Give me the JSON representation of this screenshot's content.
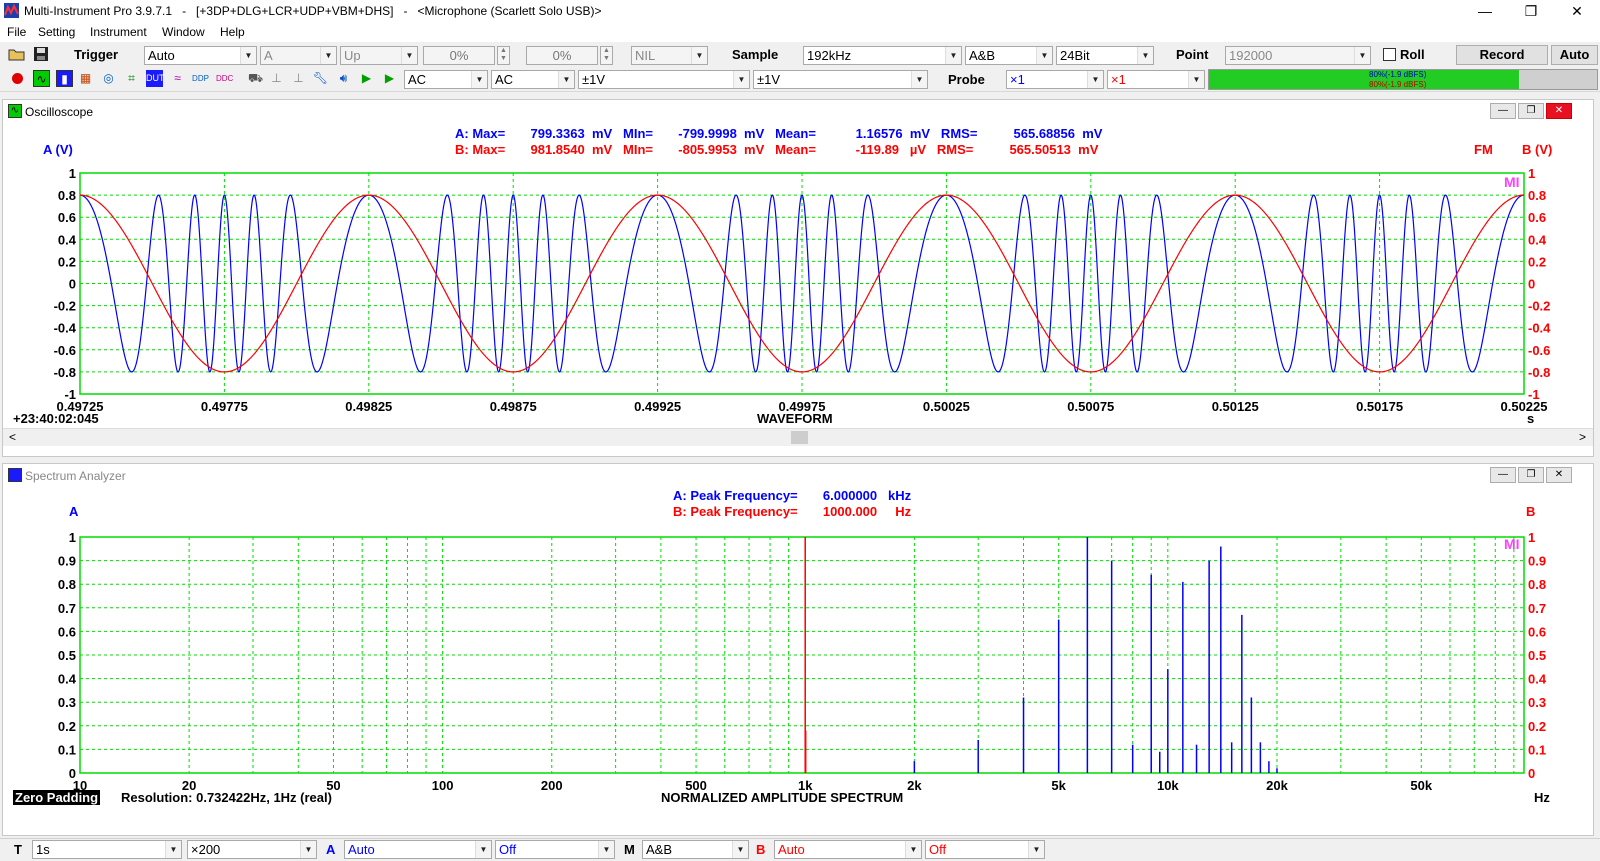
{
  "window": {
    "title": "Multi-Instrument Pro 3.9.7.1   -   [+3DP+DLG+LCR+UDP+VBM+DHS]   -   <Microphone (Scarlett Solo USB)>",
    "min_glyph": "—",
    "max_glyph": "❐",
    "close_glyph": "✕"
  },
  "menu": [
    "File",
    "Setting",
    "Instrument",
    "Window",
    "Help"
  ],
  "toolbar1": {
    "trigger_label": "Trigger",
    "trigger_mode": "Auto",
    "trigger_source": "A",
    "trigger_edge": "Up",
    "level1": "0%",
    "level2": "0%",
    "nil": "NIL",
    "sample_label": "Sample",
    "sample_rate": "192kHz",
    "channels": "A&B",
    "bits": "24Bit",
    "point_label": "Point",
    "points": "192000",
    "roll_label": "Roll",
    "record_label": "Record",
    "auto_label": "Auto"
  },
  "toolbar2": {
    "coupling_a": "AC",
    "coupling_b": "AC",
    "range_a": "±1V",
    "range_b": "±1V",
    "probe_label": "Probe",
    "probe_a": "×1",
    "probe_b": "×1",
    "meter_a": "80%(-1.9 dBFS)",
    "meter_b": "80%(-1.9 dBFS)",
    "meter_a_level": 0.8,
    "meter_b_level": 0.8
  },
  "colors": {
    "channel_a": "#0000ff",
    "channel_b": "#ff0000",
    "grid": "#00dd00",
    "meter_green": "#22cc22",
    "meter_yellow": "#dddd00"
  },
  "oscilloscope": {
    "title": "Oscilloscope",
    "a_axis_label": "A (V)",
    "b_axis_label": "B (V)",
    "mode_label": "FM",
    "watermark": "MI",
    "stats_a": "A: Max=       799.3363  mV   MIn=       -799.9998  mV   Mean=           1.16576  mV   RMS=          565.68856  mV",
    "stats_b": "B: Max=       981.8540  mV   MIn=       -805.9953  mV   Mean=           -119.89   µV   RMS=          565.50513  mV",
    "time_stamp": "+23:40:02:045",
    "x_title": "WAVEFORM",
    "x_unit": "s",
    "scroll_left": "<",
    "scroll_right": ">"
  },
  "spectrum": {
    "title": "Spectrum Analyzer",
    "a_axis_label": "A",
    "b_axis_label": "B",
    "watermark": "MI",
    "peak_a": "A: Peak Frequency=       6.000000   kHz",
    "peak_b": "B: Peak Frequency=       1000.000     Hz",
    "zero_padding_label": "Zero Padding",
    "resolution": "Resolution: 0.732422Hz, 1Hz (real)",
    "x_title": "NORMALIZED AMPLITUDE SPECTRUM",
    "x_unit": "Hz"
  },
  "bottom_bar": {
    "t_label": "T",
    "time_base": "1s",
    "zoom": "×200",
    "a_label": "A",
    "a_scale": "Auto",
    "a_mode": "Off",
    "m_label": "M",
    "m_value": "A&B",
    "b_label": "B",
    "b_scale": "Auto",
    "b_mode": "Off"
  },
  "chart_data": [
    {
      "type": "line",
      "title": "WAVEFORM",
      "xlabel": "s",
      "ylabel_left": "A (V)",
      "ylabel_right": "B (V)",
      "xlim": [
        0.49725,
        0.50225
      ],
      "ylim": [
        -1,
        1
      ],
      "x_ticks": [
        "0.49725",
        "0.49775",
        "0.49825",
        "0.49875",
        "0.49925",
        "0.49975",
        "0.50025",
        "0.50075",
        "0.50125",
        "0.50175",
        "0.50225"
      ],
      "y_ticks": [
        "1",
        "0.8",
        "0.6",
        "0.4",
        "0.2",
        "0",
        "-0.2",
        "-0.4",
        "-0.6",
        "-0.8",
        "-1"
      ],
      "grid": true,
      "series": [
        {
          "name": "A",
          "kind": "fm_sine",
          "amplitude": 0.8,
          "carrier_hz": 6000,
          "mod_period_s": 0.001,
          "min_freq_hz": 2000,
          "color": "#0000ff"
        },
        {
          "name": "B",
          "kind": "sine",
          "amplitude": 0.8,
          "freq_hz": 1000,
          "peak_at_s": 0.49725,
          "color": "#ff0000"
        }
      ]
    },
    {
      "type": "bar",
      "title": "NORMALIZED AMPLITUDE SPECTRUM",
      "xlabel": "Hz",
      "ylabel_left": "A",
      "ylabel_right": "B",
      "x_scale": "log",
      "xlim": [
        10,
        96000
      ],
      "ylim": [
        0,
        1
      ],
      "x_ticks": [
        {
          "v": 10,
          "label": "10"
        },
        {
          "v": 20,
          "label": "20"
        },
        {
          "v": 50,
          "label": "50"
        },
        {
          "v": 100,
          "label": "100"
        },
        {
          "v": 200,
          "label": "200"
        },
        {
          "v": 500,
          "label": "500"
        },
        {
          "v": 1000,
          "label": "1k"
        },
        {
          "v": 2000,
          "label": "2k"
        },
        {
          "v": 5000,
          "label": "5k"
        },
        {
          "v": 10000,
          "label": "10k"
        },
        {
          "v": 20000,
          "label": "20k"
        },
        {
          "v": 50000,
          "label": "50k"
        }
      ],
      "y_ticks": [
        "0",
        "0.1",
        "0.2",
        "0.3",
        "0.4",
        "0.5",
        "0.6",
        "0.7",
        "0.8",
        "0.9",
        "1"
      ],
      "y_ticks_right": [
        "0",
        "0.1",
        "0.2",
        "0.3",
        "0.4",
        "0.5",
        "0.6",
        "0.7",
        "0.8",
        "0.9",
        "1"
      ],
      "grid": true,
      "series": [
        {
          "name": "A",
          "color": "#0000ff",
          "points": [
            [
              2000,
              0.05
            ],
            [
              3000,
              0.14
            ],
            [
              4000,
              0.32
            ],
            [
              5000,
              0.65
            ],
            [
              6000,
              1.0
            ],
            [
              7000,
              0.9
            ],
            [
              8000,
              0.12
            ],
            [
              9000,
              0.84
            ],
            [
              9500,
              0.09
            ],
            [
              10000,
              0.44
            ],
            [
              11000,
              0.81
            ],
            [
              12000,
              0.12
            ],
            [
              13000,
              0.9
            ],
            [
              14000,
              0.96
            ],
            [
              15000,
              0.13
            ],
            [
              16000,
              0.67
            ],
            [
              17000,
              0.32
            ],
            [
              18000,
              0.13
            ],
            [
              19000,
              0.05
            ],
            [
              20000,
              0.02
            ]
          ]
        },
        {
          "name": "B",
          "color": "#ff0000",
          "points": [
            [
              1000,
              1.0
            ],
            [
              1003,
              0.18
            ]
          ]
        }
      ]
    }
  ]
}
